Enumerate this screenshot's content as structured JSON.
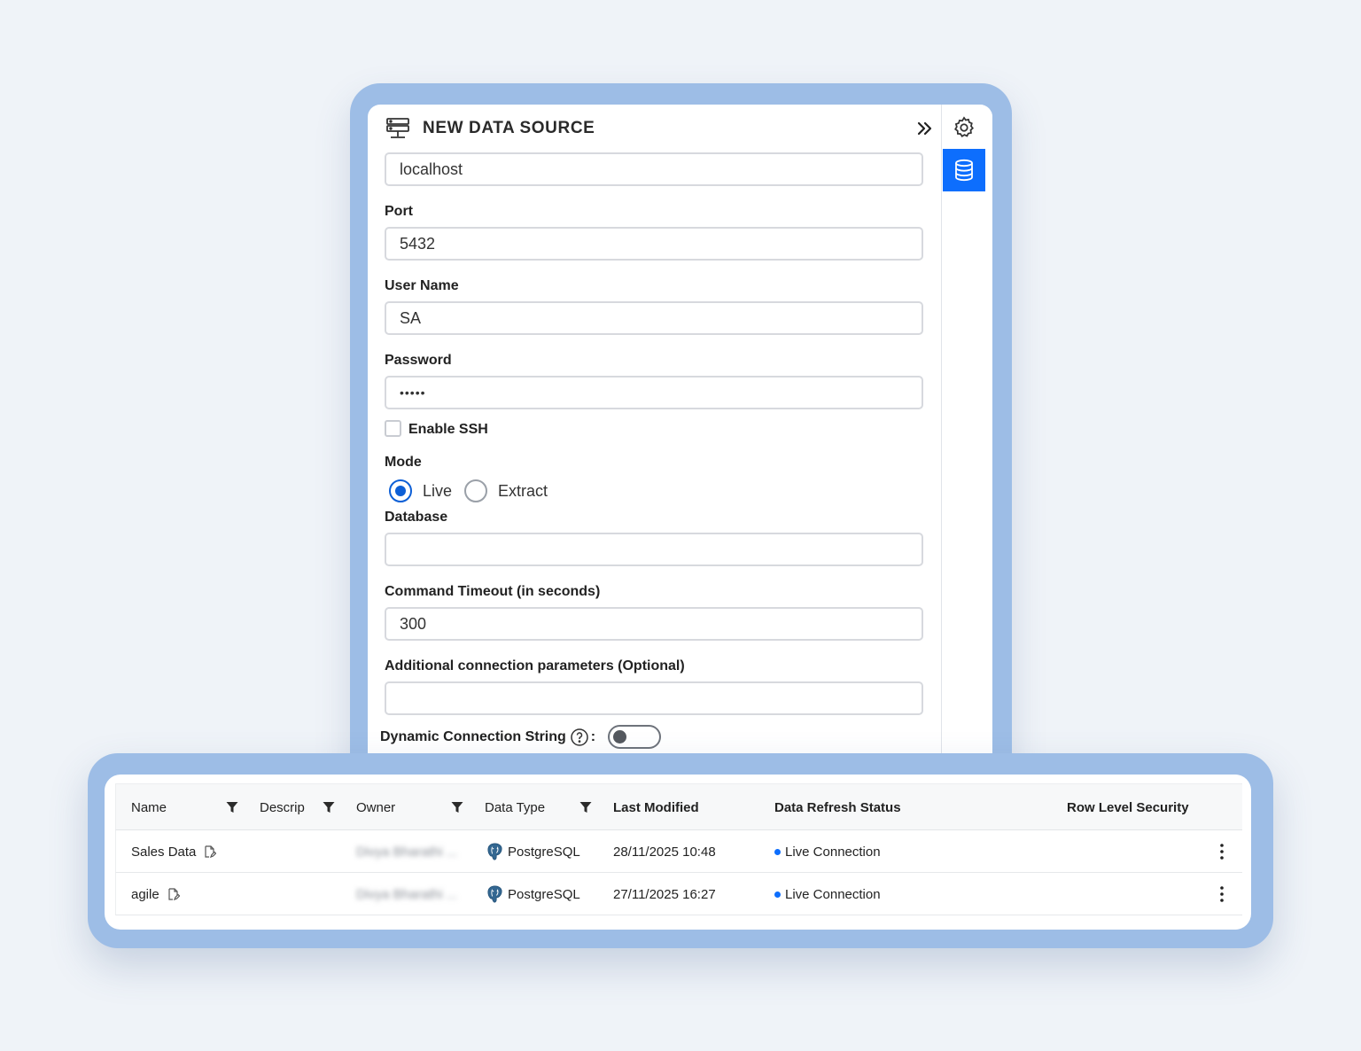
{
  "panel": {
    "title": "NEW DATA SOURCE",
    "host": {
      "value": "localhost"
    },
    "port": {
      "label": "Port",
      "value": "5432"
    },
    "username": {
      "label": "User Name",
      "value": "SA"
    },
    "password": {
      "label": "Password",
      "value": "•••••"
    },
    "ssh": {
      "label": "Enable SSH",
      "checked": false
    },
    "mode": {
      "label": "Mode",
      "options": [
        "Live",
        "Extract"
      ],
      "selected": "Live"
    },
    "database": {
      "label": "Database",
      "value": ""
    },
    "timeout": {
      "label": "Command Timeout (in seconds)",
      "value": "300"
    },
    "extra_params": {
      "label": "Additional connection parameters (Optional)",
      "value": ""
    },
    "dynamic": {
      "label": "Dynamic Connection String",
      "suffix": ":",
      "enabled": false
    }
  },
  "side_rail": {
    "icons": [
      "gear-icon",
      "database-icon"
    ],
    "active": "database-icon",
    "accent": "#0d6efd"
  },
  "table": {
    "columns": {
      "name": "Name",
      "description": "Descrip",
      "owner": "Owner",
      "data_type": "Data Type",
      "last_modified": "Last Modified",
      "refresh_status": "Data Refresh Status",
      "rls": "Row Level Security"
    },
    "rows": [
      {
        "name": "Sales Data",
        "owner": "Divya Bharathi ...",
        "data_type": "PostgreSQL",
        "last_modified": "28/11/2025 10:48",
        "status": "Live Connection"
      },
      {
        "name": "agile",
        "owner": "Divya Bharathi ...",
        "data_type": "PostgreSQL",
        "last_modified": "27/11/2025 16:27",
        "status": "Live Connection"
      }
    ]
  }
}
